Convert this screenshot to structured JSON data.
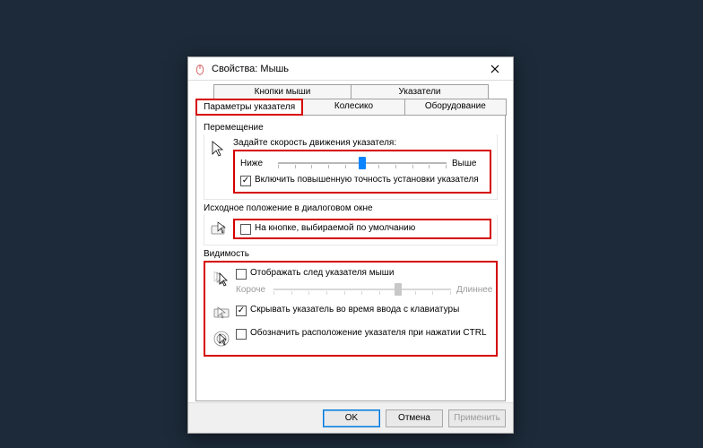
{
  "title": "Свойства: Мышь",
  "tabs": {
    "row1": [
      "Кнопки мыши",
      "Указатели"
    ],
    "row2": [
      "Параметры указателя",
      "Колесико",
      "Оборудование"
    ],
    "active": "Параметры указателя"
  },
  "groups": {
    "motion": {
      "label": "Перемещение",
      "speed_caption": "Задайте скорость движения указателя:",
      "slow": "Ниже",
      "fast": "Выше",
      "slider_value_percent": 50,
      "enhance_precision": {
        "checked": true,
        "label": "Включить повышенную точность установки указателя"
      }
    },
    "snap": {
      "label": "Исходное положение в диалоговом окне",
      "default_button": {
        "checked": false,
        "label": "На кнопке, выбираемой по умолчанию"
      }
    },
    "visibility": {
      "label": "Видимость",
      "trails": {
        "checked": false,
        "label": "Отображать след указателя мыши",
        "short": "Короче",
        "long": "Длиннее",
        "slider_value_percent": 70
      },
      "hide_typing": {
        "checked": true,
        "label": "Скрывать указатель во время ввода с клавиатуры"
      },
      "ctrl_locate": {
        "checked": false,
        "label": "Обозначить расположение указателя при нажатии CTRL"
      }
    }
  },
  "buttons": {
    "ok": "OK",
    "cancel": "Отмена",
    "apply": "Применить"
  }
}
